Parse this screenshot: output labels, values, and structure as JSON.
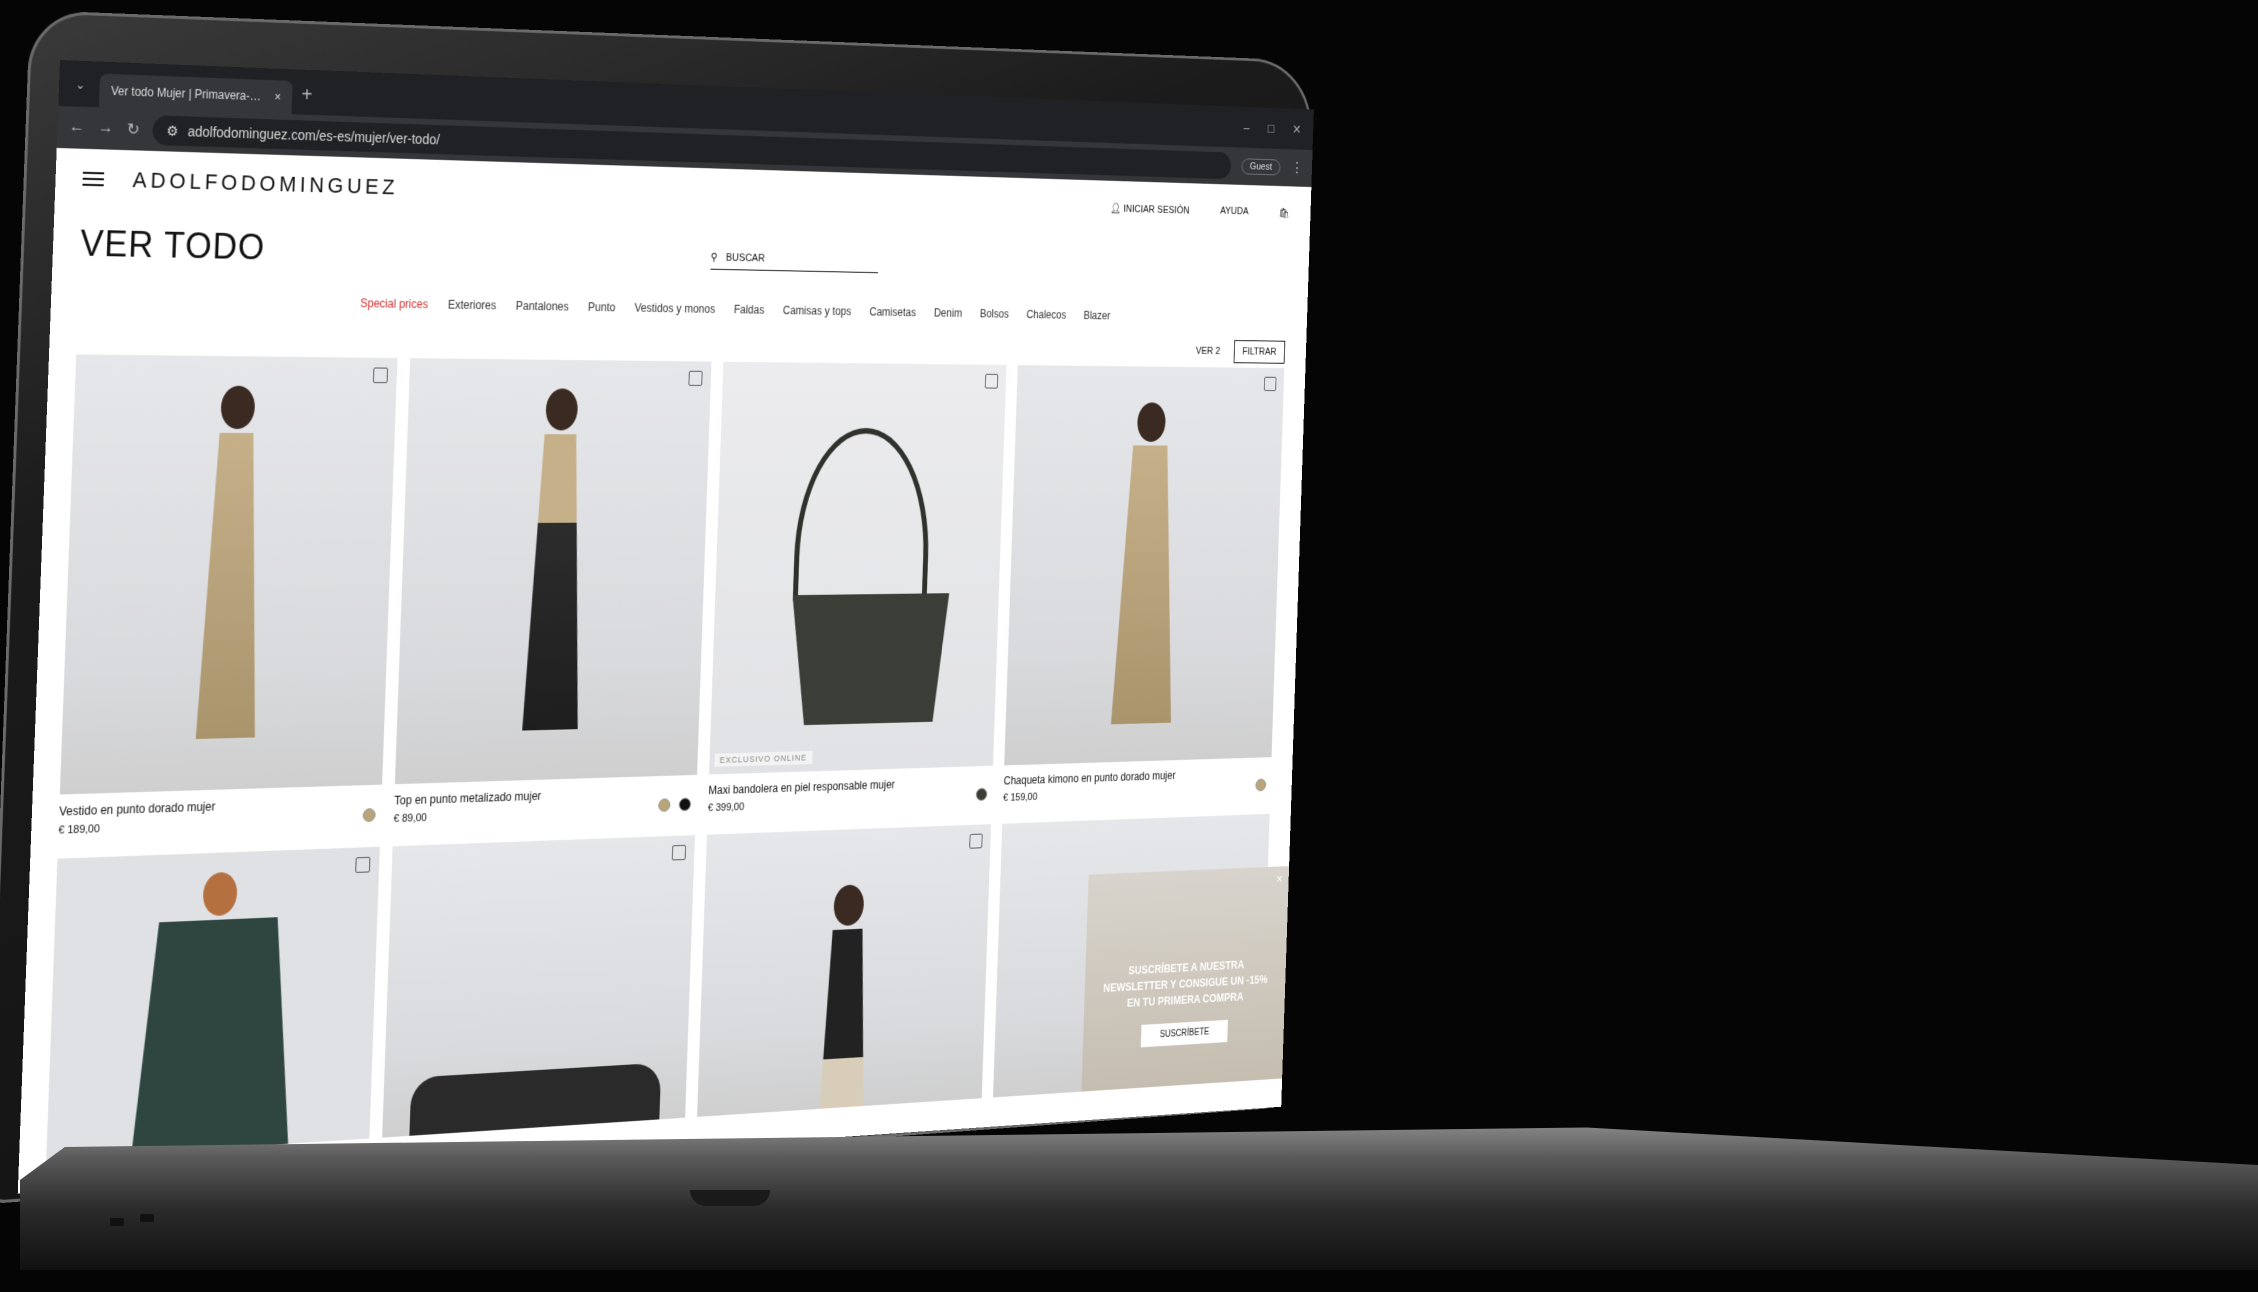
{
  "browser": {
    "tab_title": "Ver todo Mujer | Primavera-Vera",
    "tab_close": "×",
    "new_tab": "+",
    "url": "adolfodominguez.com/es-es/mujer/ver-todo/",
    "guest_label": "Guest",
    "back": "←",
    "forward": "→",
    "reload": "↻",
    "menu": "⋮",
    "win_min": "–",
    "win_max": "□",
    "win_close": "✕"
  },
  "site": {
    "logo": "ADOLFODOMINGUEZ",
    "login_label": "INICIAR SESIÓN",
    "help_label": "AYUDA",
    "page_title": "VER TODO",
    "search_placeholder": "BUSCAR",
    "categories": [
      "Special prices",
      "Exteriores",
      "Pantalones",
      "Punto",
      "Vestidos y monos",
      "Faldas",
      "Camisas y tops",
      "Camisetas",
      "Denim",
      "Bolsos",
      "Chalecos",
      "Blazer"
    ],
    "view_label": "VER 2",
    "filter_label": "FILTRAR"
  },
  "products": [
    {
      "name": "Vestido en punto dorado mujer",
      "price": "€ 189,00",
      "badge": ""
    },
    {
      "name": "Top en punto metalizado mujer",
      "price": "€ 89,00",
      "badge": ""
    },
    {
      "name": "Maxi bandolera en piel responsable mujer",
      "price": "€ 399,00",
      "badge": "EXCLUSIVO ONLINE"
    },
    {
      "name": "Chaqueta kimono en punto dorado mujer",
      "price": "€ 159,00",
      "badge": ""
    }
  ],
  "newsletter": {
    "message": "SUSCRÍBETE A NUESTRA NEWSLETTER Y CONSIGUE UN -15% EN TU PRIMERA COMPRA",
    "cta": "SUSCRÍBETE",
    "close": "×"
  },
  "colors": {
    "accent": "#d32f2f",
    "swatch_gold": "#b8a57a",
    "swatch_black": "#111111",
    "swatch_olive": "#3b3e36"
  }
}
